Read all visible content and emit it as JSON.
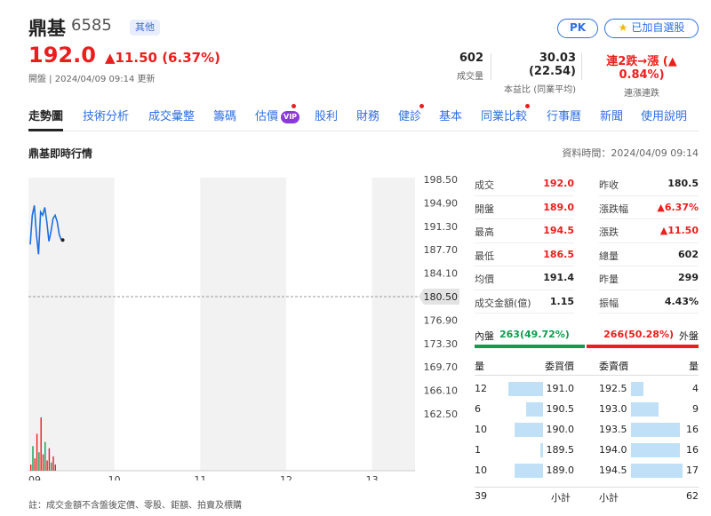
{
  "stock": {
    "name": "鼎基",
    "code": "6585",
    "tag": "其他",
    "price": "192.0",
    "change": "▲11.50 (6.37%)",
    "updated": "開盤 | 2024/04/09 09:14 更新"
  },
  "buttons": {
    "pk": "PK",
    "fav": "已加自選股"
  },
  "stats": [
    {
      "value": "602",
      "label": "成交量"
    },
    {
      "value": "30.03 (22.54)",
      "label": "本益比 (同業平均)"
    },
    {
      "value": "連2跌→漲 (▲ 0.84%)",
      "label": "連漲連跌"
    }
  ],
  "tabs": [
    "走勢圖",
    "技術分析",
    "成交彙整",
    "籌碼",
    "估價",
    "股利",
    "財務",
    "健診",
    "基本",
    "同業比較",
    "行事曆",
    "新聞",
    "使用說明"
  ],
  "vip": "VIP",
  "section": {
    "title": "鼎基即時行情",
    "time": "資料時間：2024/04/09 09:14"
  },
  "chart_data": {
    "type": "line",
    "y_ticks": [
      "198.50",
      "194.90",
      "191.30",
      "187.70",
      "184.10",
      "180.50",
      "176.90",
      "173.30",
      "169.70",
      "166.10",
      "162.50"
    ],
    "ylim": [
      162.5,
      198.5
    ],
    "x_ticks": [
      "09",
      "10",
      "11",
      "12",
      "13"
    ],
    "reference": "180.50",
    "series": [
      {
        "values": [
          188.5,
          193.0,
          194.5,
          190.0,
          187.0,
          193.5,
          193.0,
          194.2,
          192.0,
          189.0,
          190.5,
          192.5,
          193.0,
          192.0,
          190.0,
          189.2
        ]
      }
    ],
    "volume": [
      3,
      12,
      6,
      18,
      9,
      26,
      8,
      14,
      5,
      11,
      4,
      7,
      3
    ]
  },
  "quote_left": [
    {
      "label": "成交",
      "value": "192.0",
      "red": true
    },
    {
      "label": "開盤",
      "value": "189.0",
      "red": true
    },
    {
      "label": "最高",
      "value": "194.5",
      "red": true
    },
    {
      "label": "最低",
      "value": "186.5",
      "red": true
    },
    {
      "label": "均價",
      "value": "191.4",
      "red": false
    },
    {
      "label": "成交金額(億)",
      "value": "1.15",
      "red": false
    }
  ],
  "quote_right": [
    {
      "label": "昨收",
      "value": "180.5",
      "red": false
    },
    {
      "label": "漲跌幅",
      "value": "▲6.37%",
      "red": true
    },
    {
      "label": "漲跌",
      "value": "▲11.50",
      "red": true
    },
    {
      "label": "總量",
      "value": "602",
      "red": false
    },
    {
      "label": "昨量",
      "value": "299",
      "red": false
    },
    {
      "label": "振幅",
      "value": "4.43%",
      "red": false
    }
  ],
  "inout": {
    "in_label": "內盤",
    "in_value": "263(49.72%)",
    "out_value": "266(50.28%)",
    "out_label": "外盤",
    "in_ratio": 0.4972
  },
  "book_headers": {
    "qty": "量",
    "bid": "委買價",
    "ask": "委賣價"
  },
  "bids": [
    {
      "qty": "12",
      "price": "191.0",
      "n": 12
    },
    {
      "qty": "6",
      "price": "190.5",
      "n": 6
    },
    {
      "qty": "10",
      "price": "190.0",
      "n": 10
    },
    {
      "qty": "1",
      "price": "189.5",
      "n": 1
    },
    {
      "qty": "10",
      "price": "189.0",
      "n": 10
    }
  ],
  "asks": [
    {
      "price": "192.5",
      "qty": "4",
      "n": 4
    },
    {
      "price": "193.0",
      "qty": "9",
      "n": 9
    },
    {
      "price": "193.5",
      "qty": "16",
      "n": 16
    },
    {
      "price": "194.0",
      "qty": "16",
      "n": 16
    },
    {
      "price": "194.5",
      "qty": "17",
      "n": 17
    }
  ],
  "totals": {
    "bid_total": "39",
    "bid_label": "小計",
    "ask_label": "小計",
    "ask_total": "62"
  },
  "footnote": "註：成交金額不含盤後定價、零股、鉅額、拍賣及標購",
  "colors": {
    "red": "#eb1e1e",
    "green": "#0d9e4f",
    "blue": "#2f6fe4",
    "bar": "#bfe0f7"
  }
}
